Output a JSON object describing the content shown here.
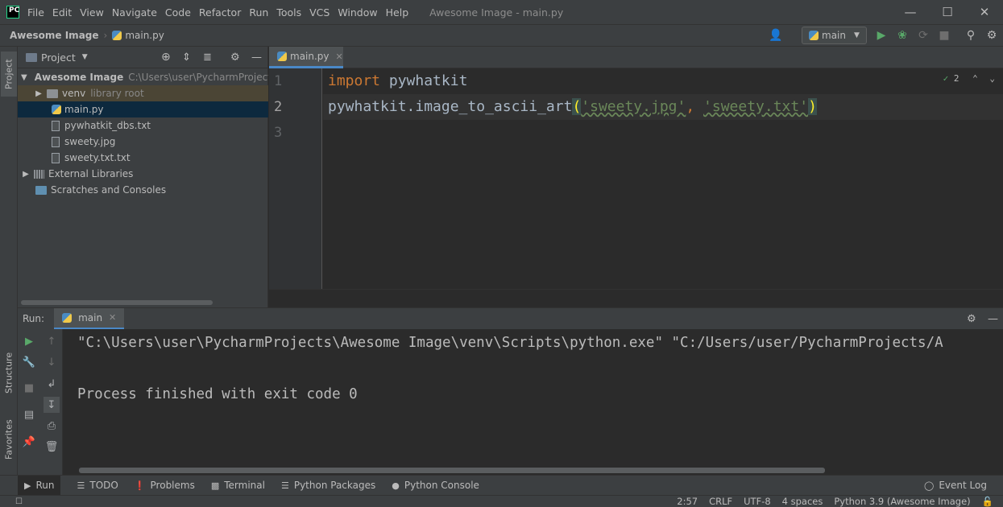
{
  "menu": {
    "items": [
      "File",
      "Edit",
      "View",
      "Navigate",
      "Code",
      "Refactor",
      "Run",
      "Tools",
      "VCS",
      "Window",
      "Help"
    ],
    "window_title": "Awesome Image - main.py"
  },
  "navbar": {
    "project": "Awesome Image",
    "file": "main.py",
    "run_config": "main"
  },
  "project_panel": {
    "title": "Project",
    "tree": [
      {
        "label": "Awesome Image",
        "note": "C:\\Users\\user\\PycharmProjects\\A"
      },
      {
        "label": "venv",
        "note": "library root"
      },
      {
        "label": "main.py"
      },
      {
        "label": "pywhatkit_dbs.txt"
      },
      {
        "label": "sweety.jpg"
      },
      {
        "label": "sweety.txt.txt"
      },
      {
        "label": "External Libraries"
      },
      {
        "label": "Scratches and Consoles"
      }
    ]
  },
  "left_strip": {
    "project": "Project",
    "structure": "Structure",
    "favorites": "Favorites"
  },
  "editor": {
    "tab": "main.py",
    "inspections": "2",
    "line_numbers": [
      "1",
      "2",
      "3"
    ],
    "line1": {
      "kw": "import",
      "rest": " pywhatkit"
    },
    "line2": {
      "call": "pywhatkit.image_to_ascii_art",
      "open": "(",
      "arg1": "'sweety.jpg'",
      "comma": ", ",
      "arg2": "'sweety.txt'",
      "close": ")"
    }
  },
  "run_panel": {
    "label": "Run:",
    "tab": "main",
    "console_line1": "\"C:\\Users\\user\\PycharmProjects\\Awesome Image\\venv\\Scripts\\python.exe\" \"C:/Users/user/PycharmProjects/A",
    "console_line2": "Process finished with exit code 0"
  },
  "bottom_bar": {
    "items": [
      "Run",
      "TODO",
      "Problems",
      "Terminal",
      "Python Packages",
      "Python Console"
    ],
    "event_log": "Event Log"
  },
  "status_bar": {
    "position": "2:57",
    "line_sep": "CRLF",
    "encoding": "UTF-8",
    "indent": "4 spaces",
    "interpreter": "Python 3.9 (Awesome Image)"
  }
}
